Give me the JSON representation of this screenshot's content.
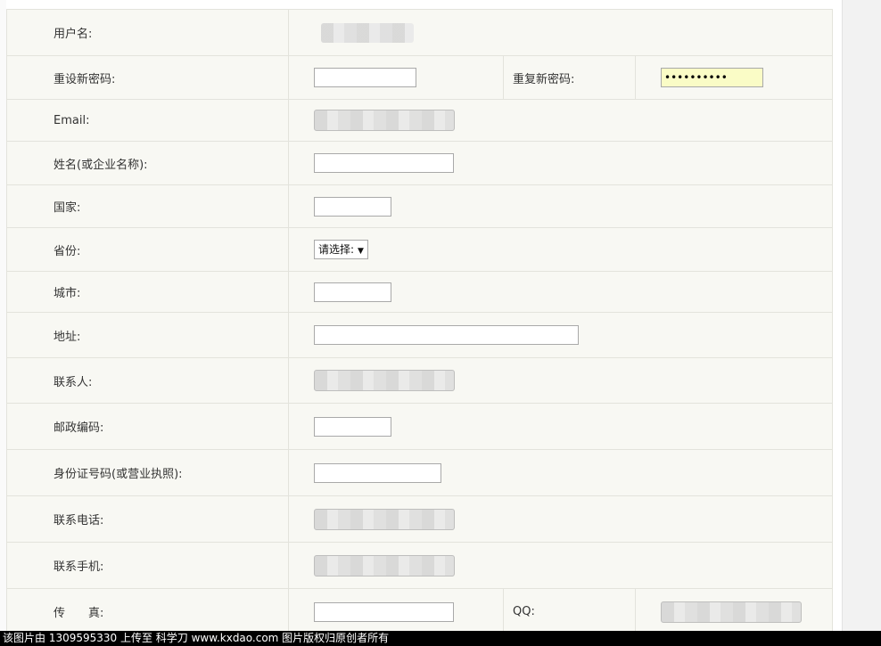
{
  "form": {
    "username_label": "用户名:",
    "reset_password_label": "重设新密码:",
    "repeat_password_label": "重复新密码:",
    "repeat_password_value": "••••••••••",
    "email_label": "Email:",
    "name_label": "姓名(或企业名称):",
    "country_label": "国家:",
    "province_label": "省份:",
    "province_value": "请选择:",
    "city_label": "城市:",
    "address_label": "地址:",
    "contact_label": "联系人:",
    "postcode_label": "邮政编码:",
    "id_label": "身份证号码(或营业执照):",
    "phone_label": "联系电话:",
    "mobile_label": "联系手机:",
    "fax_label": "传　　真:",
    "qq_label": "QQ:"
  },
  "footer": {
    "text": "该图片由 1309595330 上传至 科学刀 www.kxdao.com 图片版权归原创者所有"
  }
}
